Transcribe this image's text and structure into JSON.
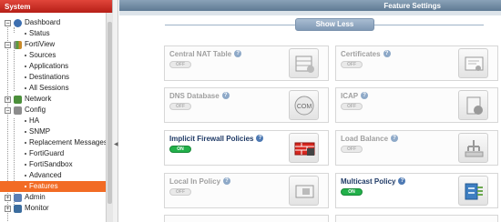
{
  "sidebar": {
    "title": "System",
    "items": [
      {
        "label": "Dashboard",
        "icon": "dashboard-icon",
        "level": 0,
        "expander": "-"
      },
      {
        "label": "Status",
        "level": 1
      },
      {
        "label": "FortiView",
        "icon": "fortiview-icon",
        "level": 0,
        "expander": "-"
      },
      {
        "label": "Sources",
        "level": 1
      },
      {
        "label": "Applications",
        "level": 1
      },
      {
        "label": "Destinations",
        "level": 1
      },
      {
        "label": "All Sessions",
        "level": 1
      },
      {
        "label": "Network",
        "icon": "network-icon",
        "level": 0,
        "expander": "+"
      },
      {
        "label": "Config",
        "icon": "config-icon",
        "level": 0,
        "expander": "-"
      },
      {
        "label": "HA",
        "level": 1
      },
      {
        "label": "SNMP",
        "level": 1
      },
      {
        "label": "Replacement Messages",
        "level": 1
      },
      {
        "label": "FortiGuard",
        "level": 1
      },
      {
        "label": "FortiSandbox",
        "level": 1
      },
      {
        "label": "Advanced",
        "level": 1
      },
      {
        "label": "Features",
        "level": 1,
        "selected": true
      },
      {
        "label": "Admin",
        "icon": "admin-icon",
        "level": 0,
        "expander": "+"
      },
      {
        "label": "Monitor",
        "icon": "monitor-icon",
        "level": 0,
        "expander": "+"
      }
    ]
  },
  "main": {
    "title": "Feature Settings",
    "show_less_label": "Show Less",
    "features": [
      {
        "name": "Central NAT Table",
        "state": "OFF",
        "enabled": false,
        "icon": "nat-table-icon"
      },
      {
        "name": "Certificates",
        "state": "OFF",
        "enabled": false,
        "icon": "certificate-icon"
      },
      {
        "name": "DNS Database",
        "state": "OFF",
        "enabled": false,
        "icon": "dns-com-icon",
        "icon_text": "COM"
      },
      {
        "name": "ICAP",
        "state": "OFF",
        "enabled": false,
        "icon": "icap-icon"
      },
      {
        "name": "Implicit Firewall Policies",
        "state": "ON",
        "enabled": true,
        "icon": "firewall-icon"
      },
      {
        "name": "Load Balance",
        "state": "OFF",
        "enabled": false,
        "icon": "load-balance-icon"
      },
      {
        "name": "Local In Policy",
        "state": "OFF",
        "enabled": false,
        "icon": "local-in-policy-icon"
      },
      {
        "name": "Multicast Policy",
        "state": "ON",
        "enabled": true,
        "icon": "multicast-icon"
      }
    ]
  },
  "colors": {
    "accent": "#f26b24",
    "on": "#22b04a",
    "header": "#6f889f",
    "system_red": "#c62a20"
  }
}
